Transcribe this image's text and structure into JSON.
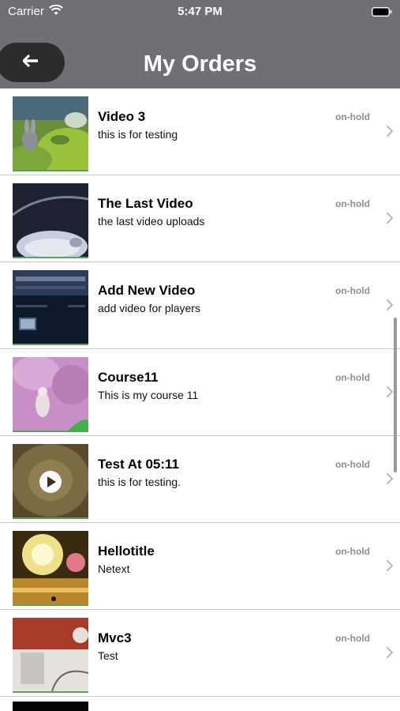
{
  "status_bar": {
    "carrier": "Carrier",
    "time": "5:47 PM"
  },
  "nav": {
    "title": "My Orders",
    "back_icon": "arrow-left-icon"
  },
  "orders": [
    {
      "title": "Video 3",
      "subtitle": "this is for testing",
      "status": "on-hold",
      "thumb": "grass-bunny"
    },
    {
      "title": "The Last Video",
      "subtitle": "the last video uploads",
      "status": "on-hold",
      "thumb": "dark-device"
    },
    {
      "title": "Add New Video",
      "subtitle": "add video for players",
      "status": "on-hold",
      "thumb": "screen-ui"
    },
    {
      "title": "Course11",
      "subtitle": "This is my course 11",
      "status": "on-hold",
      "thumb": "pink-flowers"
    },
    {
      "title": "Test At 05:11",
      "subtitle": "this is for testing.",
      "status": "on-hold",
      "thumb": "video-play"
    },
    {
      "title": "Hellotitle",
      "subtitle": "Netext",
      "status": "on-hold",
      "thumb": "fireworks"
    },
    {
      "title": "Mvc3",
      "subtitle": "Test",
      "status": "on-hold",
      "thumb": "red-object"
    }
  ],
  "colors": {
    "nav_bg": "#6e7074",
    "back_button_bg": "#2b2c2e",
    "status_text": "#8e8e93",
    "divider": "#c8c8cc"
  }
}
